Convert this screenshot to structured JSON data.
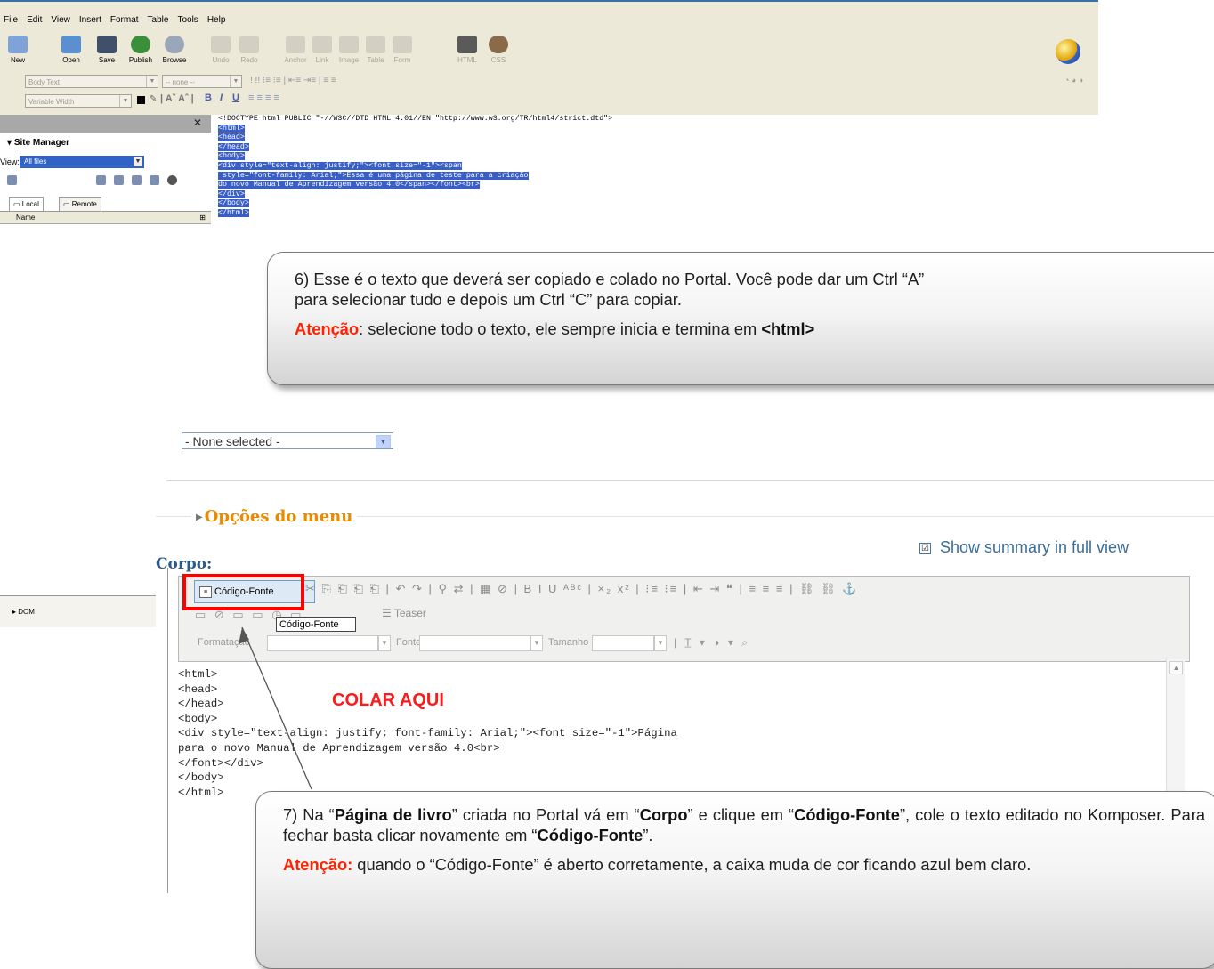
{
  "kompozer": {
    "menu": [
      "File",
      "Edit",
      "View",
      "Insert",
      "Format",
      "Table",
      "Tools",
      "Help"
    ],
    "toolbar": [
      {
        "label": "New",
        "icon": "new-icon",
        "enabled": true
      },
      {
        "label": "Open",
        "icon": "open-icon",
        "enabled": true
      },
      {
        "label": "Save",
        "icon": "save-icon",
        "enabled": true
      },
      {
        "label": "Publish",
        "icon": "publish-icon",
        "enabled": true
      },
      {
        "label": "Browse",
        "icon": "browse-icon",
        "enabled": true
      },
      {
        "label": "Undo",
        "icon": "undo-icon",
        "enabled": false
      },
      {
        "label": "Redo",
        "icon": "redo-icon",
        "enabled": false
      },
      {
        "label": "Anchor",
        "icon": "anchor-icon",
        "enabled": false
      },
      {
        "label": "Link",
        "icon": "link-icon",
        "enabled": false
      },
      {
        "label": "Image",
        "icon": "image-icon",
        "enabled": false
      },
      {
        "label": "Table",
        "icon": "table-icon",
        "enabled": false
      },
      {
        "label": "Form",
        "icon": "form-icon",
        "enabled": false
      },
      {
        "label": "HTML",
        "icon": "html-icon",
        "enabled": false
      },
      {
        "label": "CSS",
        "icon": "css-icon",
        "enabled": false
      }
    ],
    "format_bar": {
      "paragraph_style": "Body Text",
      "class": "-- none --",
      "font": "Variable Width"
    },
    "site_manager": {
      "title": "Site Manager",
      "view_label": "View:",
      "view_value": "All files",
      "tabs": [
        "Local",
        "Remote"
      ],
      "name_header": "Name",
      "dom_label": "DOM"
    },
    "source_lines": [
      {
        "text": "<!DOCTYPE html PUBLIC \"-//W3C//DTD HTML 4.01//EN \"http://www.w3.org/TR/html4/strict.dtd\">",
        "highlight": false
      },
      {
        "text": "<html>",
        "highlight": true
      },
      {
        "text": "<head>",
        "highlight": true
      },
      {
        "text": "</head>",
        "highlight": true
      },
      {
        "text": "<body>",
        "highlight": true
      },
      {
        "text": "<div style=\"text-align: justify;\"><font size=\"-1\"><span",
        "highlight": true
      },
      {
        "text": " style=\"font-family: Arial;\">Essa é uma página de teste para a criação",
        "highlight": true
      },
      {
        "text": "do novo Manual de Aprendizagem versão 4.0</span></font><br>",
        "highlight": true
      },
      {
        "text": "</div>",
        "highlight": true
      },
      {
        "text": "</body>",
        "highlight": true
      },
      {
        "text": "</html>",
        "highlight": true
      }
    ]
  },
  "portal": {
    "select_value": "- None selected -",
    "section_title": "Opções do menu",
    "show_summary": "Show summary in full view",
    "corpo_label": "Corpo:",
    "source_button": "Código-Fonte",
    "tooltip": "Código-Fonte",
    "teaser_label": "Teaser",
    "format_label": "Formatação",
    "font_label": "Fonte",
    "size_label": "Tamanho",
    "code_lines": [
      "<html>",
      "<head>",
      "</head>",
      "<body>",
      "<div style=\"text-align: justify; font-family: Arial;\"><font size=\"-1\">Página",
      "para o novo Manual de Aprendizagem versão 4.0<br>",
      "</font></div>",
      "</body>",
      "</html>"
    ],
    "paste_here": "COLAR AQUI"
  },
  "callout6": {
    "line1": "6) Esse é o texto que deverá ser copiado e colado no Portal. Você pode dar um Ctrl “A”",
    "line2": "para selecionar tudo e depois um Ctrl “C” para copiar.",
    "att_label": "Atenção",
    "att_text": ": selecione todo o texto, ele sempre inicia e termina em ",
    "att_tag": "<html>"
  },
  "callout7": {
    "t1": "7) Na “",
    "b1": "Página de livro",
    "t2": "” criada no Portal vá em “",
    "b2": "Corpo",
    "t3": "” e clique em “",
    "b3": "Código-Fonte",
    "t4": "”, cole o texto editado no Komposer. Para fechar basta clicar novamente em “",
    "b4": "Código-Fonte",
    "t5": "”.",
    "att_label": "Atenção:",
    "att_text": " quando o “Código-Fonte” é aberto corretamente, a caixa muda de cor ficando azul bem claro."
  },
  "colors": {
    "highlight": "#3a5ec8",
    "orange": "#e98b00",
    "red": "#ff0000",
    "corpo": "#2c5a89"
  }
}
